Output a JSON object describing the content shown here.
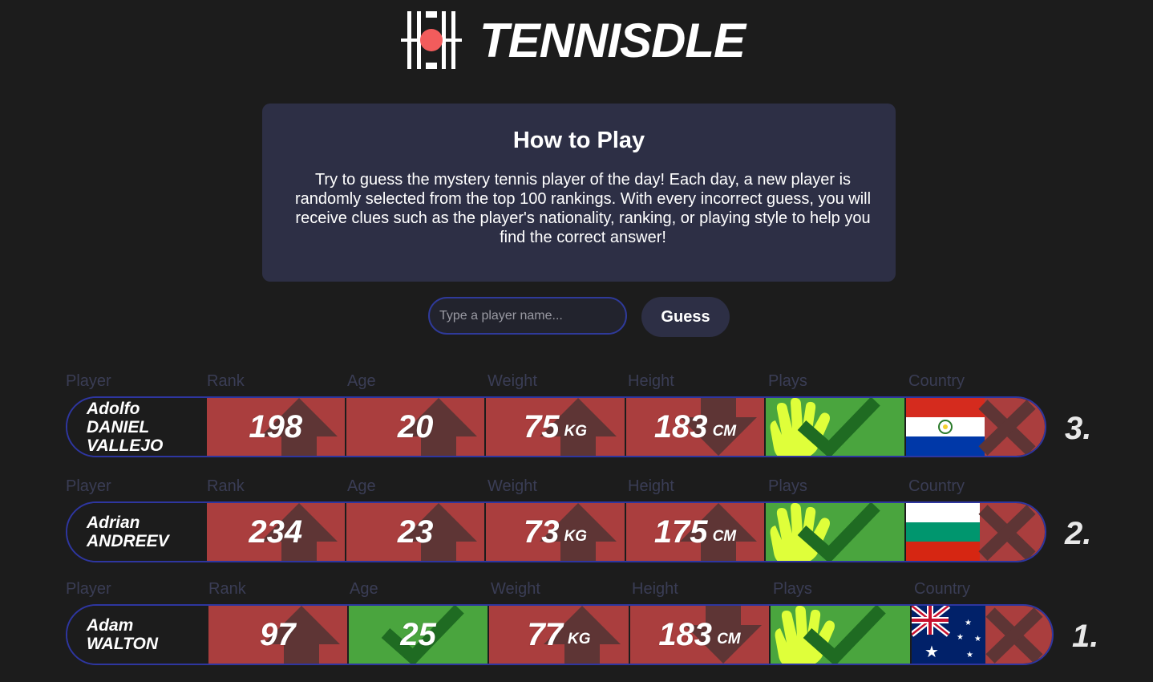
{
  "header": {
    "title": "TENNISDLE",
    "accent": "#f25c5c"
  },
  "howto": {
    "title": "How to Play",
    "text": "Try to guess the mystery tennis player of the day! Each day, a new player is randomly selected from the top 100 rankings. With every incorrect guess, you will receive clues such as the player's nationality, ranking, or playing style to help you find the correct answer!"
  },
  "search": {
    "placeholder": "Type a player name...",
    "value": ""
  },
  "guess_button": "Guess",
  "columns": {
    "player": "Player",
    "rank": "Rank",
    "age": "Age",
    "weight": "Weight",
    "height": "Height",
    "plays": "Plays",
    "country": "Country"
  },
  "units": {
    "weight": "KG",
    "height": "CM"
  },
  "colors": {
    "wrong": "#aa3e3e",
    "correct": "#4aa53e",
    "border": "#2e36a0",
    "hand": "#dfff3a"
  },
  "guesses": [
    {
      "number": "3.",
      "name": [
        "Adolfo",
        "DANIEL",
        "VALLEJO"
      ],
      "rank": "198",
      "rank_status": "wrong",
      "rank_hint": "up-arrow-icon",
      "age": "20",
      "age_status": "wrong",
      "age_hint": "up-arrow-icon",
      "weight": "75",
      "weight_status": "wrong",
      "weight_hint": "up-arrow-icon",
      "height": "183",
      "height_status": "wrong",
      "height_hint": "down-arrow-icon",
      "plays_status": "correct",
      "plays_icon": "right-hand-icon",
      "country_flag": "paraguay-flag-icon",
      "country_status": "wrong"
    },
    {
      "number": "2.",
      "name": [
        "Adrian",
        "ANDREEV"
      ],
      "rank": "234",
      "rank_status": "wrong",
      "rank_hint": "up-arrow-icon",
      "age": "23",
      "age_status": "wrong",
      "age_hint": "up-arrow-icon",
      "weight": "73",
      "weight_status": "wrong",
      "weight_hint": "up-arrow-icon",
      "height": "175",
      "height_status": "wrong",
      "height_hint": "up-arrow-icon",
      "plays_status": "correct",
      "plays_icon": "right-hand-icon",
      "country_flag": "bulgaria-flag-icon",
      "country_status": "wrong"
    },
    {
      "number": "1.",
      "name": [
        "Adam",
        "WALTON"
      ],
      "rank": "97",
      "rank_status": "wrong",
      "rank_hint": "up-arrow-icon",
      "age": "25",
      "age_status": "correct",
      "age_hint": "check-icon",
      "weight": "77",
      "weight_status": "wrong",
      "weight_hint": "up-arrow-icon",
      "height": "183",
      "height_status": "wrong",
      "height_hint": "down-arrow-icon",
      "plays_status": "correct",
      "plays_icon": "right-hand-icon",
      "country_flag": "australia-flag-icon",
      "country_status": "wrong"
    }
  ]
}
